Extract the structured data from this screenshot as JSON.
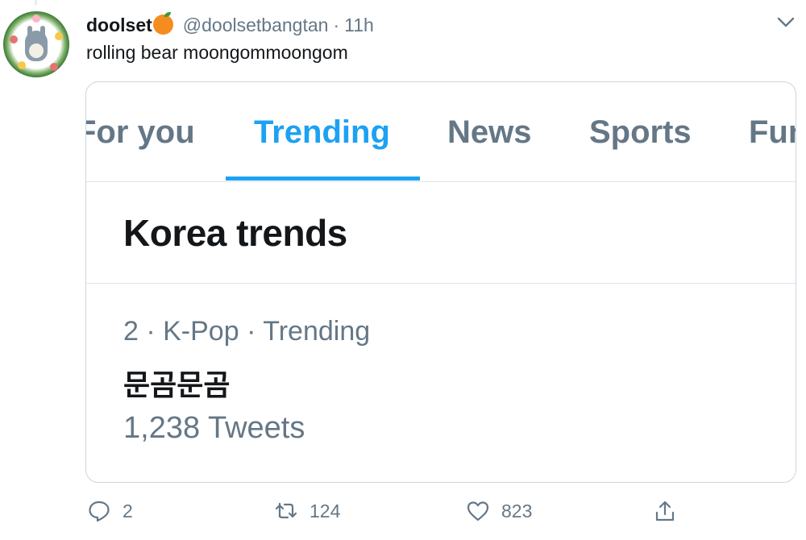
{
  "tweet": {
    "display_name": "doolset",
    "handle": "@doolsetbangtan",
    "separator": "·",
    "time": "11h",
    "text": "rolling bear moongommoongom",
    "avatar_icon": "totoro-avatar",
    "name_emoji_icon": "orange-emoji-icon"
  },
  "card": {
    "tabs": [
      {
        "label": "For you",
        "active": false
      },
      {
        "label": "Trending",
        "active": true
      },
      {
        "label": "News",
        "active": false
      },
      {
        "label": "Sports",
        "active": false
      },
      {
        "label": "Fun",
        "active": false
      }
    ],
    "section_title": "Korea trends",
    "trend": {
      "meta": "2 · K-Pop · Trending",
      "name": "문곰문곰",
      "count": "1,238 Tweets"
    }
  },
  "actions": {
    "reply_count": "2",
    "retweet_count": "124",
    "like_count": "823"
  },
  "colors": {
    "accent": "#1da1f2",
    "secondary_text": "#657786",
    "border": "#ccd6dd",
    "orange": "#f58c1f"
  }
}
